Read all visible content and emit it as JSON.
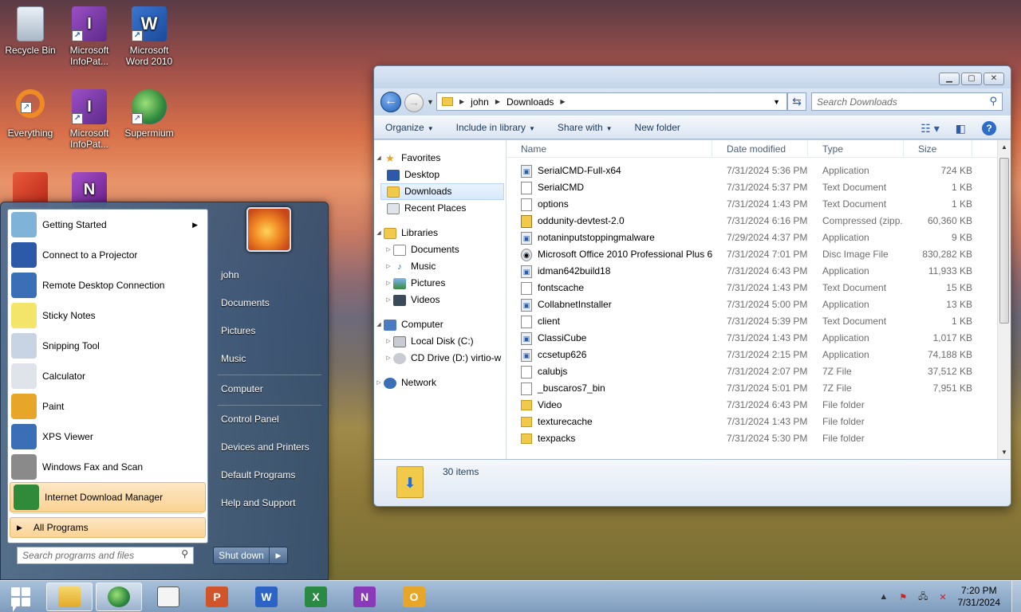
{
  "desktop": {
    "icons": [
      {
        "label": "Recycle Bin",
        "icon": "recycle-bin-icon"
      },
      {
        "label": "Microsoft InfoPat...",
        "icon": "infopath-icon"
      },
      {
        "label": "Microsoft Word 2010",
        "icon": "word-icon"
      },
      {
        "label": "Everything",
        "icon": "everything-search-icon"
      },
      {
        "label": "Microsoft InfoPat...",
        "icon": "infopath-icon"
      },
      {
        "label": "Supermium",
        "icon": "browser-icon"
      },
      {
        "label": "",
        "icon": "app-icon"
      },
      {
        "label": "",
        "icon": "onenote-icon"
      }
    ]
  },
  "explorer": {
    "breadcrumb": [
      "john",
      "Downloads"
    ],
    "search_placeholder": "Search Downloads",
    "toolbar": {
      "organize": "Organize",
      "include": "Include in library",
      "share": "Share with",
      "new_folder": "New folder"
    },
    "nav": {
      "favorites": "Favorites",
      "desktop": "Desktop",
      "downloads": "Downloads",
      "recent": "Recent Places",
      "libraries": "Libraries",
      "documents": "Documents",
      "music": "Music",
      "pictures": "Pictures",
      "videos": "Videos",
      "computer": "Computer",
      "local_disk": "Local Disk (C:)",
      "cd_drive": "CD Drive (D:) virtio-w",
      "network": "Network"
    },
    "columns": {
      "name": "Name",
      "date": "Date modified",
      "type": "Type",
      "size": "Size"
    },
    "files": [
      {
        "name": "SerialCMD-Full-x64",
        "date": "7/31/2024 5:36 PM",
        "type": "Application",
        "size": "724 KB",
        "kind": "app"
      },
      {
        "name": "SerialCMD",
        "date": "7/31/2024 5:37 PM",
        "type": "Text Document",
        "size": "1 KB",
        "kind": "txt"
      },
      {
        "name": "options",
        "date": "7/31/2024 1:43 PM",
        "type": "Text Document",
        "size": "1 KB",
        "kind": "txt"
      },
      {
        "name": "oddunity-devtest-2.0",
        "date": "7/31/2024 6:16 PM",
        "type": "Compressed (zipp...",
        "size": "60,360 KB",
        "kind": "zip"
      },
      {
        "name": "notaninputstoppingmalware",
        "date": "7/29/2024 4:37 PM",
        "type": "Application",
        "size": "9 KB",
        "kind": "app"
      },
      {
        "name": "Microsoft Office 2010 Professional Plus 6...",
        "date": "7/31/2024 7:01 PM",
        "type": "Disc Image File",
        "size": "830,282 KB",
        "kind": "disc"
      },
      {
        "name": "idman642build18",
        "date": "7/31/2024 6:43 PM",
        "type": "Application",
        "size": "11,933 KB",
        "kind": "app"
      },
      {
        "name": "fontscache",
        "date": "7/31/2024 1:43 PM",
        "type": "Text Document",
        "size": "15 KB",
        "kind": "txt"
      },
      {
        "name": "CollabnetInstaller",
        "date": "7/31/2024 5:00 PM",
        "type": "Application",
        "size": "13 KB",
        "kind": "app"
      },
      {
        "name": "client",
        "date": "7/31/2024 5:39 PM",
        "type": "Text Document",
        "size": "1 KB",
        "kind": "txt"
      },
      {
        "name": "ClassiCube",
        "date": "7/31/2024 1:43 PM",
        "type": "Application",
        "size": "1,017 KB",
        "kind": "app"
      },
      {
        "name": "ccsetup626",
        "date": "7/31/2024 2:15 PM",
        "type": "Application",
        "size": "74,188 KB",
        "kind": "app"
      },
      {
        "name": "calubjs",
        "date": "7/31/2024 2:07 PM",
        "type": "7Z File",
        "size": "37,512 KB",
        "kind": "txt"
      },
      {
        "name": "_buscaros7_bin",
        "date": "7/31/2024 5:01 PM",
        "type": "7Z File",
        "size": "7,951 KB",
        "kind": "txt"
      },
      {
        "name": "Video",
        "date": "7/31/2024 6:43 PM",
        "type": "File folder",
        "size": "",
        "kind": "folder"
      },
      {
        "name": "texturecache",
        "date": "7/31/2024 1:43 PM",
        "type": "File folder",
        "size": "",
        "kind": "folder"
      },
      {
        "name": "texpacks",
        "date": "7/31/2024 5:30 PM",
        "type": "File folder",
        "size": "",
        "kind": "folder"
      }
    ],
    "item_count": "30 items"
  },
  "start_menu": {
    "programs": [
      {
        "label": "Getting Started",
        "icon": "getting-started-icon",
        "has_arrow": true
      },
      {
        "label": "Connect to a Projector",
        "icon": "projector-icon"
      },
      {
        "label": "Remote Desktop Connection",
        "icon": "remote-desktop-icon"
      },
      {
        "label": "Sticky Notes",
        "icon": "sticky-notes-icon"
      },
      {
        "label": "Snipping Tool",
        "icon": "snipping-tool-icon"
      },
      {
        "label": "Calculator",
        "icon": "calculator-icon"
      },
      {
        "label": "Paint",
        "icon": "paint-icon"
      },
      {
        "label": "XPS Viewer",
        "icon": "xps-viewer-icon"
      },
      {
        "label": "Windows Fax and Scan",
        "icon": "fax-scan-icon"
      },
      {
        "label": "Internet Download Manager",
        "icon": "idm-icon"
      }
    ],
    "all_programs": "All Programs",
    "search_placeholder": "Search programs and files",
    "right": {
      "user": "john",
      "documents": "Documents",
      "pictures": "Pictures",
      "music": "Music",
      "computer": "Computer",
      "control_panel": "Control Panel",
      "devices": "Devices and Printers",
      "default_programs": "Default Programs",
      "help": "Help and Support"
    },
    "shutdown": "Shut down"
  },
  "taskbar": {
    "clock_time": "7:20 PM",
    "clock_date": "7/31/2024"
  }
}
